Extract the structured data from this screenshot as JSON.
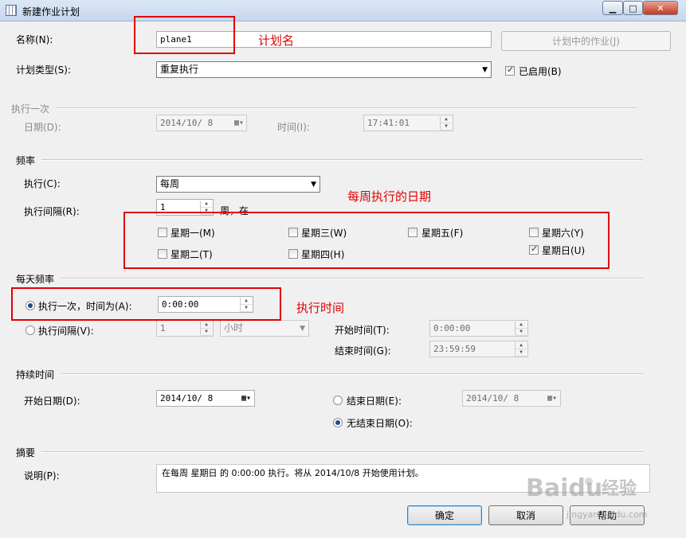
{
  "window": {
    "title": "新建作业计划",
    "min_symbol": "▁",
    "max_symbol": "□",
    "close_symbol": "✕"
  },
  "name": {
    "label": "名称(N):",
    "value": "plane1"
  },
  "jobs_in_plan_button": "计划中的作业(J)",
  "plan_type": {
    "label": "计划类型(S):",
    "value": "重复执行"
  },
  "enabled": {
    "label": "已启用(B)",
    "checked": true
  },
  "once": {
    "title": "执行一次",
    "date_label": "日期(D):",
    "date_value": "2014/10/ 8",
    "time_label": "时间(I):",
    "time_value": "17:41:01"
  },
  "frequency": {
    "title": "频率",
    "execute_label": "执行(C):",
    "execute_value": "每周",
    "interval_label": "执行间隔(R):",
    "interval_value": "1",
    "interval_suffix": "周，在",
    "days": [
      {
        "label": "星期一(M)",
        "checked": false
      },
      {
        "label": "星期三(W)",
        "checked": false
      },
      {
        "label": "星期五(F)",
        "checked": false
      },
      {
        "label": "星期六(Y)",
        "checked": false
      },
      {
        "label": "星期二(T)",
        "checked": false
      },
      {
        "label": "星期四(H)",
        "checked": false
      },
      {
        "label": "星期日(U)",
        "checked": true
      }
    ]
  },
  "daily": {
    "title": "每天频率",
    "once_label": "执行一次，时间为(A):",
    "once_value": "0:00:00",
    "interval_label": "执行间隔(V):",
    "interval_value": "1",
    "interval_unit": "小时",
    "start_label": "开始时间(T):",
    "start_value": "0:00:00",
    "end_label": "结束时间(G):",
    "end_value": "23:59:59"
  },
  "duration": {
    "title": "持续时间",
    "start_label": "开始日期(D):",
    "start_value": "2014/10/ 8",
    "end_label": "结束日期(E):",
    "end_value": "2014/10/ 8",
    "no_end_label": "无结束日期(O):"
  },
  "summary": {
    "title": "摘要",
    "desc_label": "说明(P):",
    "desc_value": "在每周 星期日 的 0:00:00 执行。将从 2014/10/8 开始使用计划。"
  },
  "buttons": {
    "ok": "确定",
    "cancel": "取消",
    "help": "帮助"
  },
  "annotations": {
    "plan_name": "计划名",
    "weekly_days": "每周执行的日期",
    "exec_time": "执行时间",
    "color": "#e00000"
  },
  "watermark": {
    "brand": "Baidu",
    "cn": "经验",
    "url": "jingyan.baidu.com"
  }
}
